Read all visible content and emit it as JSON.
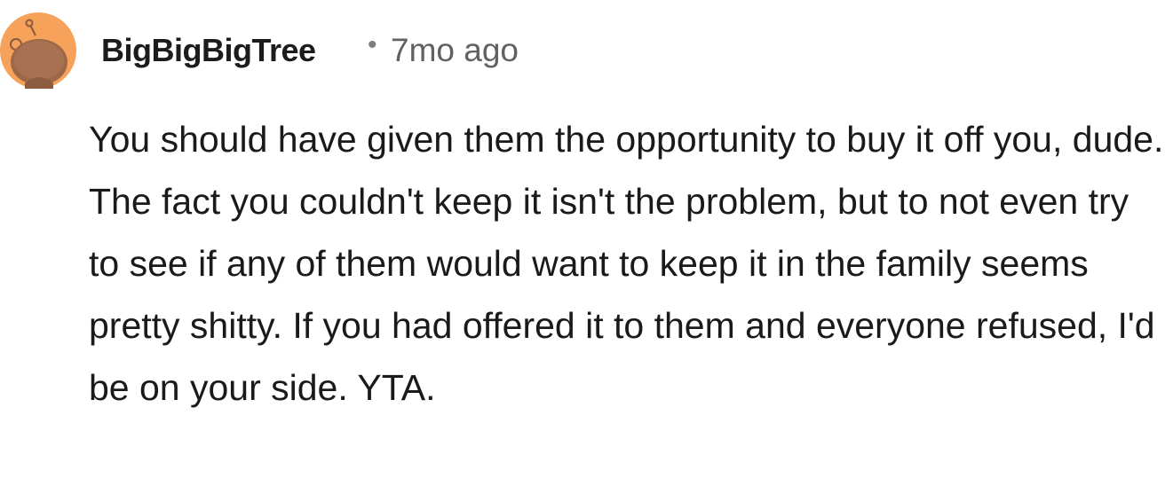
{
  "comment": {
    "author": "BigBigBigTree",
    "separator": "•",
    "timestamp": "7mo ago",
    "avatar_icon": "snoo-avatar-icon",
    "avatar_color": "#F6A25A",
    "body": "You should have given them the opportunity to buy it off you, dude. The fact you couldn't keep it isn't the problem, but to not even try to see if any of them would want to keep it in the family seems pretty shitty. If you had offered it to them and everyone refused, I'd be on your side. YTA."
  }
}
